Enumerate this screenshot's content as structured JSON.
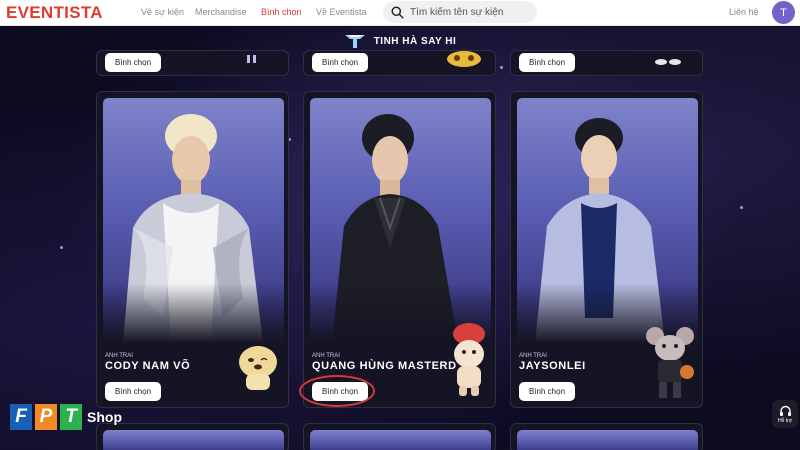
{
  "header": {
    "logo": "EVENTISTA",
    "nav": [
      "Về sự kiện",
      "Merchandise",
      "Bình chọn",
      "Về Eventista"
    ],
    "active_nav": "Bình chọn",
    "search_placeholder": "Tìm kiếm tên sự kiện",
    "contact": "Liên hệ",
    "avatar_initial": "T"
  },
  "section": {
    "title": "TINH HÀ SAY HI"
  },
  "vote_label": "Bình chọn",
  "cards": [
    {
      "kicker": "ANH TRAI",
      "name": "CODY NAM VÕ",
      "vote": "Bình chọn"
    },
    {
      "kicker": "ANH TRAI",
      "name": "QUANG HÙNG MASTERD",
      "vote": "Bình chọn"
    },
    {
      "kicker": "ANH TRAI",
      "name": "JAYSONLEI",
      "vote": "Bình chọn"
    }
  ],
  "watermark": {
    "brand_letters": [
      "F",
      "P",
      "T"
    ],
    "shop": "Shop"
  },
  "support": {
    "label": "Hỗ trợ"
  },
  "colors": {
    "brand_red": "#e23a2e",
    "avatar": "#7262c9",
    "background": "#0c0b20",
    "card": "#141424",
    "highlight": "#d63a3a",
    "fpt_blue": "#1a5fb4",
    "fpt_orange": "#f08a24",
    "fpt_green": "#2bb24c"
  }
}
